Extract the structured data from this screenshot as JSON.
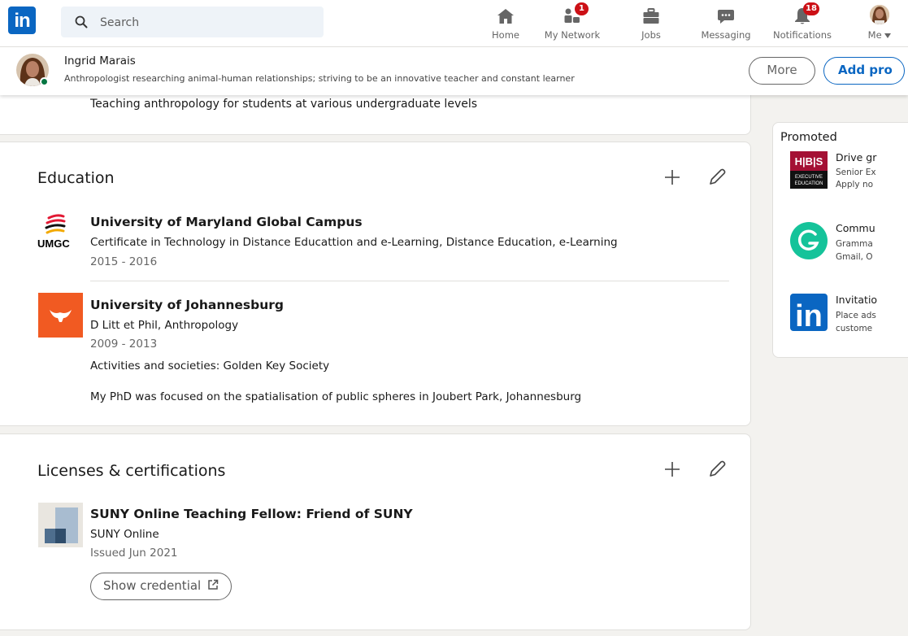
{
  "nav": {
    "logo_text": "in",
    "search_placeholder": "Search",
    "items": [
      {
        "label": "Home",
        "icon": "home-icon"
      },
      {
        "label": "My Network",
        "icon": "people-icon",
        "badge": "1"
      },
      {
        "label": "Jobs",
        "icon": "briefcase-icon"
      },
      {
        "label": "Messaging",
        "icon": "chat-icon"
      },
      {
        "label": "Notifications",
        "icon": "bell-icon",
        "badge": "18"
      },
      {
        "label": "Me",
        "icon": "avatar-icon"
      }
    ]
  },
  "profile_bar": {
    "name": "Ingrid Marais",
    "headline": "Anthropologist researching animal-human relationships; striving to be an innovative teacher and constant learner",
    "more_label": "More",
    "add_label": "Add pro"
  },
  "experience": {
    "description": "Teaching anthropology for students at various undergraduate levels"
  },
  "education": {
    "title": "Education",
    "items": [
      {
        "school": "University of Maryland Global Campus",
        "degree": "Certificate in Technology in Distance Educattion and e-Learning, Distance Education, e-Learning",
        "dates": "2015 - 2016",
        "logo_text": "UMGC"
      },
      {
        "school": "University of Johannesburg",
        "degree": "D Litt et Phil, Anthropology",
        "dates": "2009 - 2013",
        "activities": "Activities and societies: Golden Key Society",
        "description": "My PhD was focused on the spatialisation of public spheres in Joubert Park, Johannesburg"
      }
    ]
  },
  "licenses": {
    "title": "Licenses & certifications",
    "items": [
      {
        "name": "SUNY Online Teaching Fellow: Friend of SUNY",
        "issuer": "SUNY Online",
        "issued": "Issued Jun 2021",
        "button": "Show credential"
      }
    ]
  },
  "promoted": {
    "title": "Promoted",
    "items": [
      {
        "head": "Drive gr",
        "line1": "Senior Ex",
        "line2": "Apply no",
        "logo_lines": [
          "H|B|S",
          "EXECUTIVE",
          "EDUCATION"
        ]
      },
      {
        "head": "Commu",
        "line1": "Gramma",
        "line2": "Gmail, O",
        "logo": "grammarly-logo"
      },
      {
        "head": "Invitatio",
        "line1": "Place ads",
        "line2": "custome",
        "logo_text": "in"
      }
    ]
  },
  "colors": {
    "brand": "#0a66c2",
    "badge": "#cc1016",
    "online": "#057642",
    "uj_orange": "#f15a22",
    "grammarly": "#15c39a",
    "hbs": "#a41034"
  }
}
